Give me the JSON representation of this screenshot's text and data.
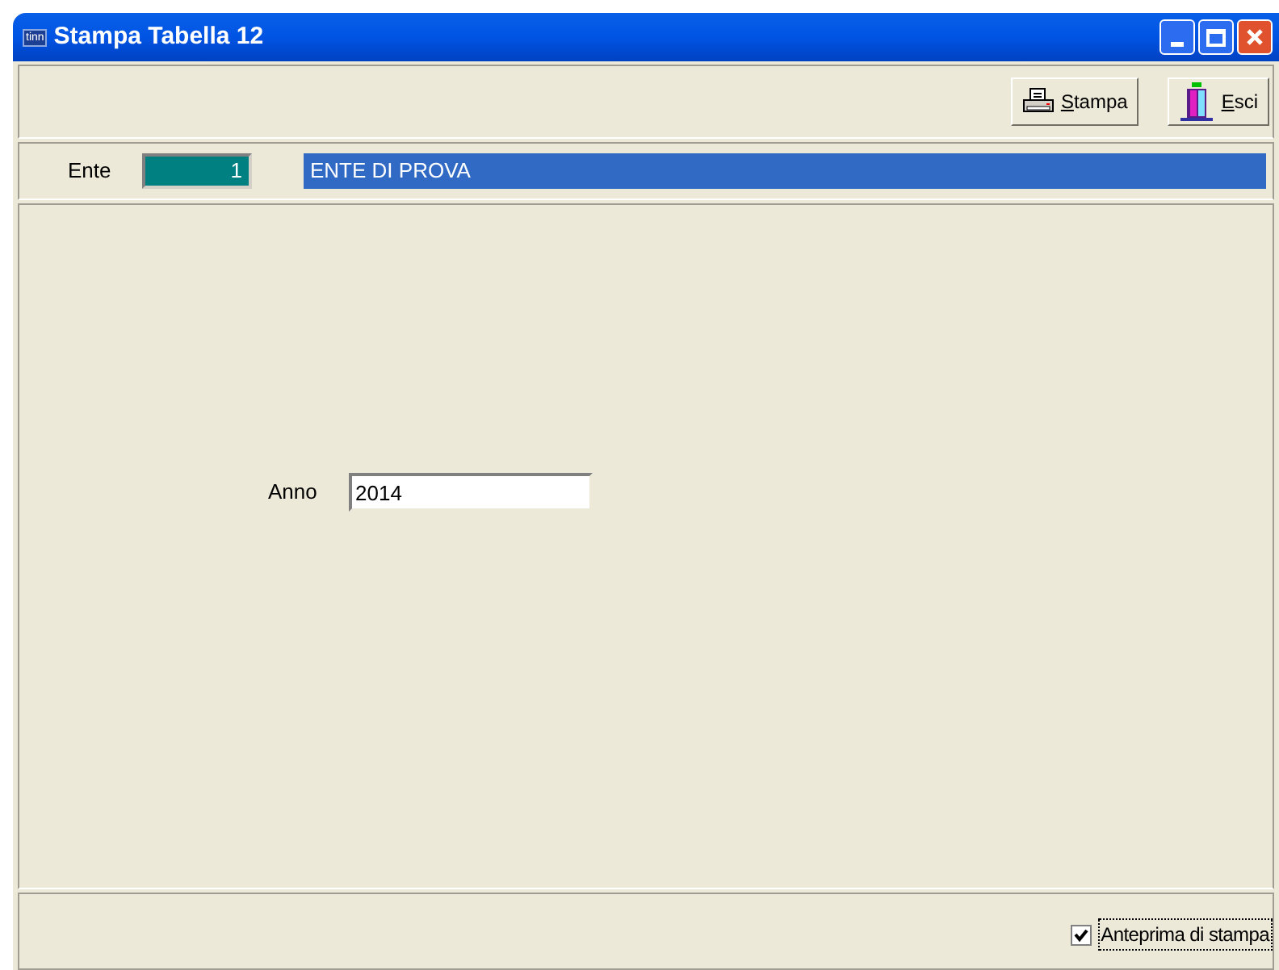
{
  "window": {
    "title": "Stampa Tabella 12",
    "icon_text": "tinn"
  },
  "toolbar": {
    "buttons": [
      {
        "kind": "print",
        "label": "Stampa"
      },
      {
        "kind": "exit",
        "label": "Esci"
      }
    ]
  },
  "ente": {
    "label": "Ente",
    "code": "1",
    "name": "ENTE DI PROVA"
  },
  "form": {
    "anno": {
      "label": "Anno",
      "value": "2014"
    }
  },
  "footer": {
    "preview": {
      "label": "Anteprima di stampa",
      "checked": true
    }
  }
}
